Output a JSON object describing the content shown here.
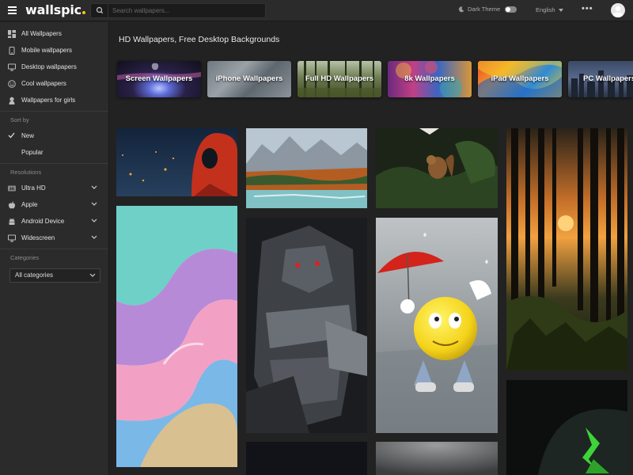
{
  "header": {
    "logo": "wallspic",
    "search_placeholder": "Search wallpapers...",
    "theme_label": "Dark Theme",
    "language": "English",
    "more": "•••"
  },
  "sidebar": {
    "items": [
      {
        "label": "All Wallpapers",
        "icon": "grid-icon"
      },
      {
        "label": "Mobile wallpapers",
        "icon": "phone-icon"
      },
      {
        "label": "Desktop wallpapers",
        "icon": "monitor-icon"
      },
      {
        "label": "Cool wallpapers",
        "icon": "smile-icon"
      },
      {
        "label": "Wallpapers for girls",
        "icon": "girl-icon"
      }
    ],
    "sort_heading": "Sort by",
    "sort_options": [
      {
        "label": "New",
        "selected": true
      },
      {
        "label": "Popular",
        "selected": false
      }
    ],
    "resolutions_heading": "Resolutions",
    "resolutions": [
      {
        "label": "Ultra HD",
        "icon": "uhd-icon"
      },
      {
        "label": "Apple",
        "icon": "apple-icon"
      },
      {
        "label": "Android Device",
        "icon": "android-icon"
      },
      {
        "label": "Widescreen",
        "icon": "widescreen-icon"
      }
    ],
    "categories_heading": "Categories",
    "categories_select": "All categories"
  },
  "main": {
    "title": "HD Wallpapers, Free Desktop Backgrounds",
    "categories": [
      {
        "label": "Screen Wallpapers"
      },
      {
        "label": "iPhone Wallpapers"
      },
      {
        "label": "Full HD Wallpapers"
      },
      {
        "label": "8k Wallpapers"
      },
      {
        "label": "iPad Wallpapers"
      },
      {
        "label": "PC Wallpapers"
      }
    ],
    "tiles": [
      {
        "subject": "spider-man"
      },
      {
        "subject": "mountain-lake"
      },
      {
        "subject": "squirrel"
      },
      {
        "subject": "forest-sunset"
      },
      {
        "subject": "abstract-wave"
      },
      {
        "subject": "robot"
      },
      {
        "subject": "emoji-umbrella"
      },
      {
        "subject": "green-abstract"
      }
    ]
  },
  "colors": {
    "background": "#222222",
    "sidebar": "#2b2b2b",
    "logo_dot": "#f5c518"
  }
}
